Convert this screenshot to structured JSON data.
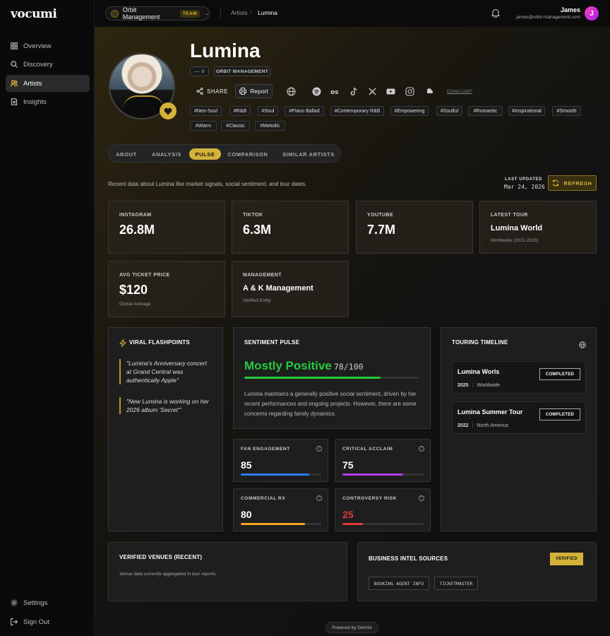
{
  "app": {
    "logo": "vocumi"
  },
  "sidebar": {
    "items": [
      {
        "label": "Overview",
        "icon": "grid-icon"
      },
      {
        "label": "Discovery",
        "icon": "search-icon"
      },
      {
        "label": "Artists",
        "icon": "users-icon"
      },
      {
        "label": "Insights",
        "icon": "document-icon"
      }
    ],
    "bottom": [
      {
        "label": "Settings",
        "icon": "gear-icon"
      },
      {
        "label": "Sign Out",
        "icon": "sign-out-icon"
      }
    ]
  },
  "topbar": {
    "org": "Orbit Management",
    "team_badge": "TEAM",
    "breadcrumb": [
      "Artists",
      "Lumina"
    ],
    "user_name": "James",
    "user_email": "james@orbit-management.com",
    "avatar_letter": "J"
  },
  "artist": {
    "name": "Lumina",
    "count": "0",
    "management_chip": "ORBIT MANAGEMENT",
    "share_label": "SHARE",
    "report_label": "Report",
    "correct_link": "Correct Link?",
    "tags": [
      "#Neo-Soul",
      "#R&B",
      "#Soul",
      "#Piano Ballad",
      "#Contemporary R&B",
      "#Empowering",
      "#Soulful",
      "#Romantic",
      "#Inspirational",
      "#Smooth",
      "#Warm",
      "#Classic",
      "#Melodic"
    ]
  },
  "tabs": [
    "ABOUT",
    "ANALYSIS",
    "PULSE",
    "COMPARISON",
    "SIMILAR ARTISTS"
  ],
  "pulse": {
    "description": "Recent data about Lumina like market signals, social sentiment, and tour dates.",
    "last_updated_label": "LAST UPDATED",
    "last_updated_value": "Mar 24, 2026",
    "refresh_label": "REFRESH"
  },
  "stats": [
    {
      "label": "INSTAGRAM",
      "value": "26.8M"
    },
    {
      "label": "TIKTOK",
      "value": "6.3M"
    },
    {
      "label": "YOUTUBE",
      "value": "7.7M"
    },
    {
      "label": "LATEST TOUR",
      "value": "Lumina World",
      "sub": "Worldwide (2022-2023)"
    },
    {
      "label": "AVG TICKET PRICE",
      "value": "$120",
      "sub": "Global Average"
    },
    {
      "label": "MANAGEMENT",
      "value": "A & K Management",
      "sub": "Verified Entity"
    }
  ],
  "viral": {
    "title": "VIRAL FLASHPOINTS",
    "quotes": [
      "\"Lumina's Anniversary concert at Grand Central was authentically Apple\"",
      "\"New Lumina is working on her 2026 album 'Secret'\""
    ]
  },
  "sentiment": {
    "title": "SENTIMENT PULSE",
    "headline": "Mostly Positive",
    "score": "78/100",
    "score_value": 78,
    "text": "Lumina maintains a generally positive social sentiment, driven by her recent performances and ongoing projects. However, there are some concerns regarding family dynamics."
  },
  "metrics": [
    {
      "label": "FAN ENGAGEMENT",
      "value": "85",
      "pct": 85,
      "color": "#2f7bf5"
    },
    {
      "label": "CRITICAL ACCLAIM",
      "value": "75",
      "pct": 75,
      "color": "#b23af0"
    },
    {
      "label": "COMMERCIAL RX",
      "value": "80",
      "pct": 80,
      "color": "#f5a623"
    },
    {
      "label": "CONTROVERSY RISK",
      "value": "25",
      "pct": 25,
      "color": "#e23b3b"
    }
  ],
  "touring": {
    "title": "TOURING TIMELINE",
    "items": [
      {
        "name": "Lumina Worls",
        "year": "2025",
        "region": "Worldwide",
        "status": "COMPLETED"
      },
      {
        "name": "Lumina Summer Tour",
        "year": "2022",
        "region": "North America",
        "status": "COMPLETED"
      }
    ]
  },
  "venues": {
    "title": "VERIFIED VENUES (RECENT)",
    "note": "Venue data currently aggregated in tour reports."
  },
  "intel": {
    "title": "BUSINESS INTEL SOURCES",
    "badge": "VERIFIED",
    "sources": [
      "BOOKING AGENT INFO",
      "TICKETMASTER"
    ]
  },
  "footer": {
    "powered": "Powered by Gemini"
  },
  "colors": {
    "accent": "#d4b23a",
    "positive": "#27c93f"
  }
}
